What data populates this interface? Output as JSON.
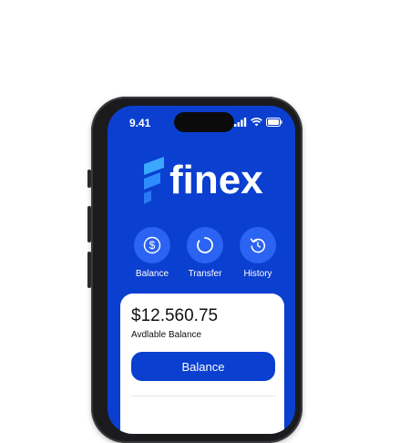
{
  "status_bar": {
    "time": "9.41"
  },
  "brand": {
    "name": "finex"
  },
  "actions": [
    {
      "label": "Balance"
    },
    {
      "label": "Transfer"
    },
    {
      "label": "History"
    }
  ],
  "balance_card": {
    "amount": "$12.560.75",
    "label": "Avdlable Balance",
    "button_label": "Balance"
  },
  "colors": {
    "brand_blue": "#0a3fd0",
    "accent_blue": "#2b63f2",
    "logo_cyan": "#3aa8ff"
  }
}
